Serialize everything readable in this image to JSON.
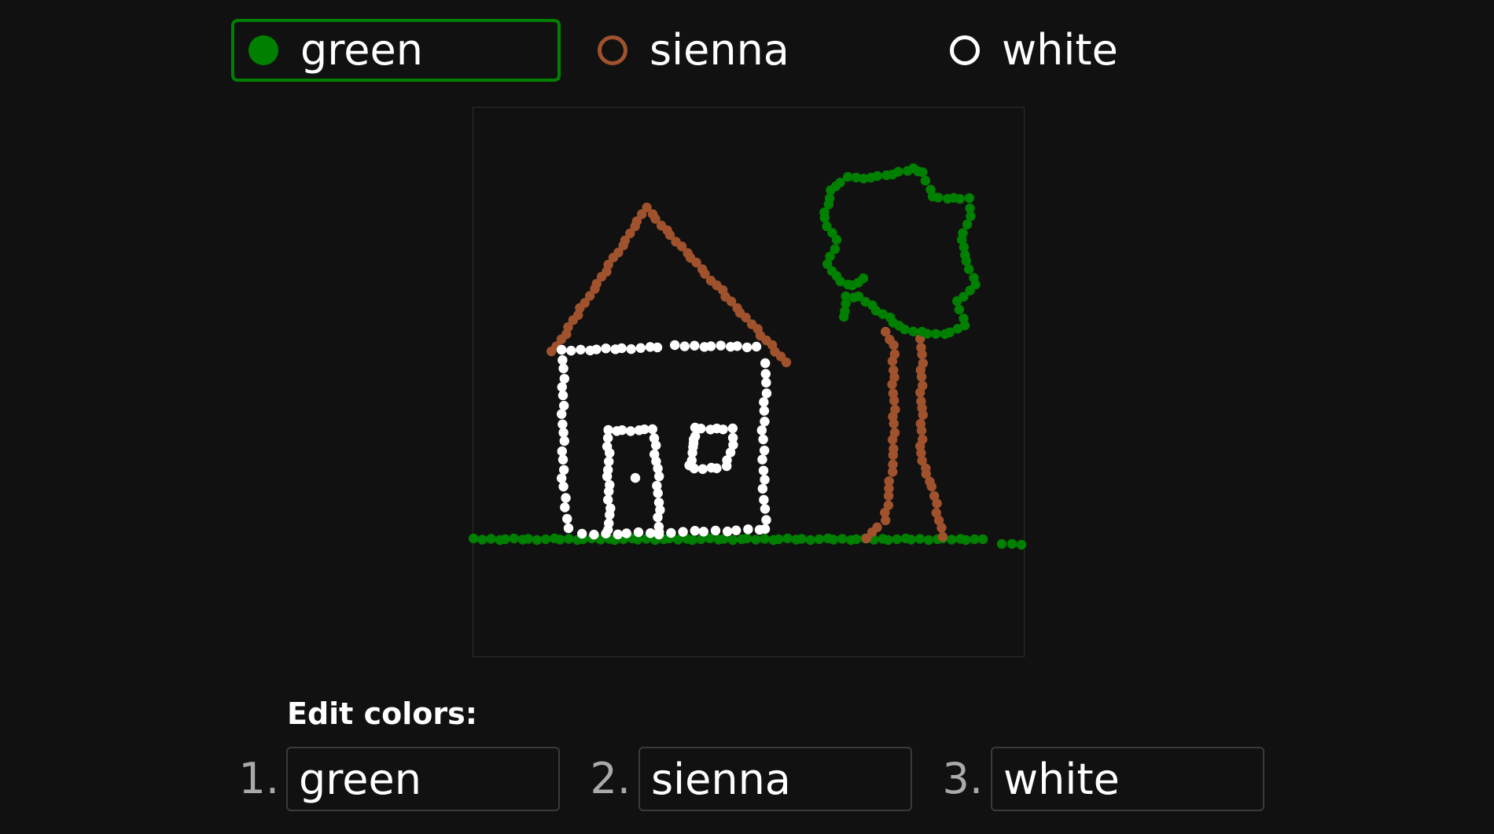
{
  "palette": {
    "options": [
      {
        "label": "green",
        "color": "#008000",
        "selected": true
      },
      {
        "label": "sienna",
        "color": "#a0522d",
        "selected": false
      },
      {
        "label": "white",
        "color": "#ffffff",
        "selected": false
      }
    ]
  },
  "edit": {
    "heading": "Edit colors:",
    "fields": [
      {
        "number": "1.",
        "value": "green"
      },
      {
        "number": "2.",
        "value": "sienna"
      },
      {
        "number": "3.",
        "value": "white"
      }
    ]
  },
  "drawing": {
    "colors": {
      "green": "#008000",
      "sienna": "#a0522d",
      "white": "#ffffff"
    }
  }
}
